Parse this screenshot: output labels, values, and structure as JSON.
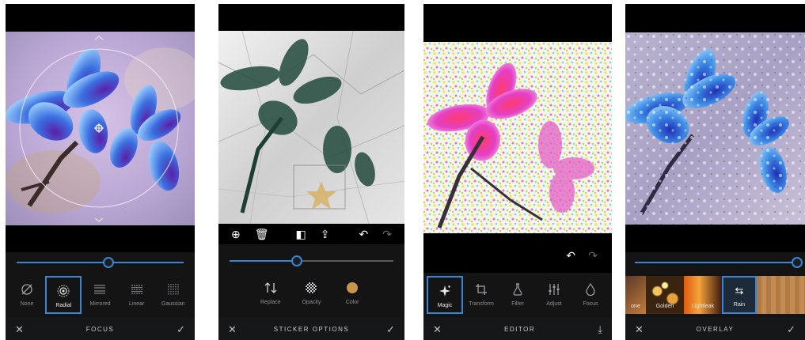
{
  "colors": {
    "accent": "#3a84d6",
    "panel_bg": "#1c1d1f",
    "toolbar_bg": "#141415"
  },
  "panel1": {
    "title": "FOCUS",
    "slider_level": 0.55,
    "tools": [
      {
        "label": "None",
        "icon": "circle-slash-icon"
      },
      {
        "label": "Radial",
        "icon": "radial-icon",
        "selected": true
      },
      {
        "label": "Mirrored",
        "icon": "mirrored-lines-icon"
      },
      {
        "label": "Linear",
        "icon": "linear-lines-icon"
      },
      {
        "label": "Gaussian",
        "icon": "grid-dots-icon"
      }
    ]
  },
  "panel2": {
    "title": "STICKER OPTIONS",
    "slider_level": 0.41,
    "tools": [
      {
        "label": "Replace",
        "icon": "swap-arrows-icon"
      },
      {
        "label": "Opacity",
        "icon": "checker-circle-icon"
      },
      {
        "label": "Color",
        "icon": "color-dot-icon"
      }
    ]
  },
  "panel3": {
    "title": "EDITOR",
    "tools": [
      {
        "label": "Magic",
        "icon": "sparkle-icon",
        "selected": true
      },
      {
        "label": "Transform",
        "icon": "crop-rotate-icon"
      },
      {
        "label": "Filter",
        "icon": "flask-icon"
      },
      {
        "label": "Adjust",
        "icon": "sliders-icon"
      },
      {
        "label": "Focus",
        "icon": "drop-icon"
      }
    ]
  },
  "panel4": {
    "title": "OVERLAY",
    "slider_level": 1.0,
    "thumbs": [
      {
        "label": "one"
      },
      {
        "label": "Golden"
      },
      {
        "label": "Lightleak"
      },
      {
        "label": "Rain",
        "selected": true
      },
      {
        "label": "Wood"
      }
    ]
  }
}
